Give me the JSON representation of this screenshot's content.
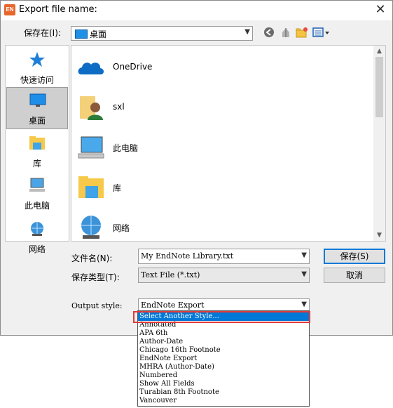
{
  "window": {
    "title": "Export file name:",
    "app_icon": "EN"
  },
  "lookin": {
    "label": "保存在(I):",
    "value": "桌面"
  },
  "places": [
    {
      "label": "快速访问",
      "icon": "star-icon"
    },
    {
      "label": "桌面",
      "icon": "desktop-icon",
      "selected": true
    },
    {
      "label": "库",
      "icon": "library-icon"
    },
    {
      "label": "此电脑",
      "icon": "computer-icon"
    },
    {
      "label": "网络",
      "icon": "network-icon"
    }
  ],
  "items": [
    {
      "label": "OneDrive",
      "icon": "onedrive-icon"
    },
    {
      "label": "sxl",
      "icon": "user-folder-icon"
    },
    {
      "label": "此电脑",
      "icon": "computer-icon"
    },
    {
      "label": "库",
      "icon": "library-icon"
    },
    {
      "label": "网络",
      "icon": "network-icon"
    }
  ],
  "filename": {
    "label": "文件名(N):",
    "value": "My EndNote Library.txt"
  },
  "filetype": {
    "label": "保存类型(T):",
    "value": "Text File (*.txt)"
  },
  "buttons": {
    "save": "保存(S)",
    "cancel": "取消"
  },
  "output_style": {
    "label": "Output style:",
    "value": "EndNote Export",
    "options": [
      "Select Another Style...",
      "Annotated",
      "APA 6th",
      "Author-Date",
      "Chicago 16th Footnote",
      "EndNote Export",
      "MHRA (Author-Date)",
      "Numbered",
      "Show All Fields",
      "Turabian 8th Footnote",
      "Vancouver"
    ],
    "highlighted": "Select Another Style..."
  },
  "colors": {
    "accent": "#0078d7",
    "highlight_box": "#e23a3a"
  }
}
